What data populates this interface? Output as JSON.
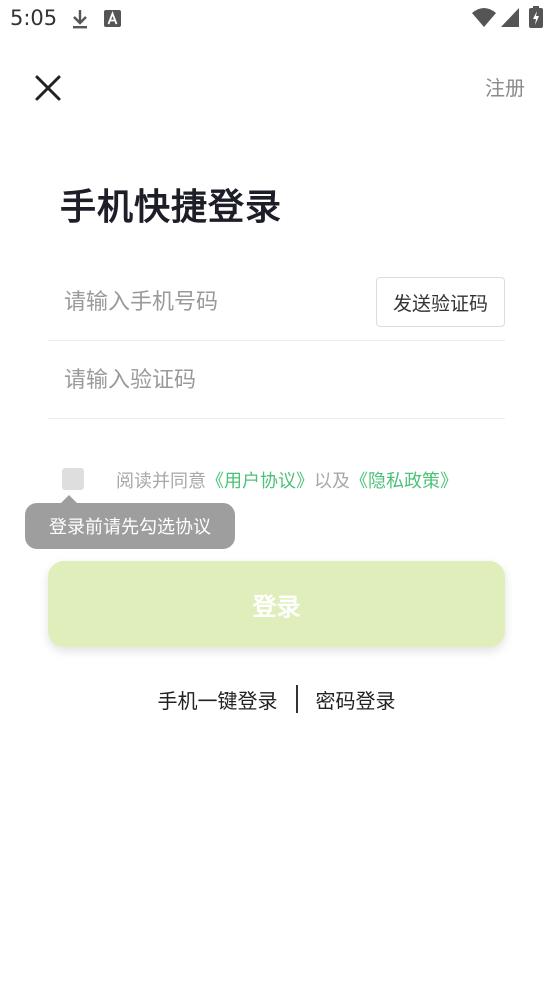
{
  "status_bar": {
    "time": "5:05"
  },
  "header": {
    "register_label": "注册"
  },
  "title": "手机快捷登录",
  "phone": {
    "placeholder": "请输入手机号码",
    "send_code_label": "发送验证码"
  },
  "code": {
    "placeholder": "请输入验证码"
  },
  "agreement": {
    "prefix": "阅读并同意",
    "user_agreement": "《用户协议》",
    "mid": "以及",
    "privacy_policy": "《隐私政策》",
    "tooltip": "登录前请先勾选协议"
  },
  "login_button": "登录",
  "alt_login": {
    "one_click": "手机一键登录",
    "password": "密码登录"
  },
  "colors": {
    "accent_green": "#4cc178",
    "login_button_bg": "#e0eebb",
    "tooltip_bg": "#9e9e9e"
  }
}
